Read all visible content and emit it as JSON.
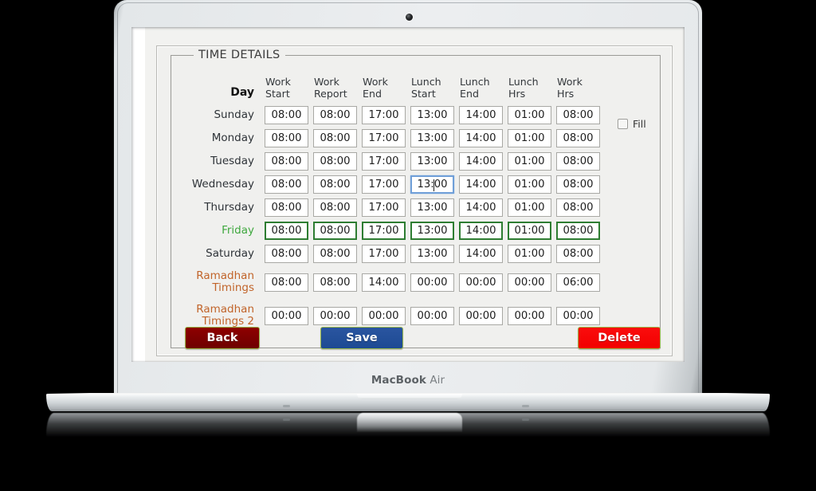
{
  "device": {
    "brand": "MacBook",
    "model": "Air",
    "camera_icon": "camera-dot"
  },
  "window": {
    "fieldset_legend": "TIME DETAILS"
  },
  "table": {
    "day_header": "Day",
    "columns": [
      {
        "line1": "Work",
        "line2": "Start"
      },
      {
        "line1": "Work",
        "line2": "Report"
      },
      {
        "line1": "Work",
        "line2": "End"
      },
      {
        "line1": "Lunch",
        "line2": "Start"
      },
      {
        "line1": "Lunch",
        "line2": "End"
      },
      {
        "line1": "Lunch",
        "line2": "Hrs"
      },
      {
        "line1": "Work",
        "line2": "Hrs"
      }
    ],
    "rows": [
      {
        "day": "Sunday",
        "style": "normal",
        "values": [
          "08:00",
          "08:00",
          "17:00",
          "13:00",
          "14:00",
          "01:00",
          "08:00"
        ]
      },
      {
        "day": "Monday",
        "style": "normal",
        "values": [
          "08:00",
          "08:00",
          "17:00",
          "13:00",
          "14:00",
          "01:00",
          "08:00"
        ]
      },
      {
        "day": "Tuesday",
        "style": "normal",
        "values": [
          "08:00",
          "08:00",
          "17:00",
          "13:00",
          "14:00",
          "01:00",
          "08:00"
        ]
      },
      {
        "day": "Wednesday",
        "style": "normal",
        "values": [
          "08:00",
          "08:00",
          "17:00",
          "13:00",
          "14:00",
          "01:00",
          "08:00"
        ],
        "focused_index": 3
      },
      {
        "day": "Thursday",
        "style": "normal",
        "values": [
          "08:00",
          "08:00",
          "17:00",
          "13:00",
          "14:00",
          "01:00",
          "08:00"
        ]
      },
      {
        "day": "Friday",
        "style": "friday",
        "values": [
          "08:00",
          "08:00",
          "17:00",
          "13:00",
          "14:00",
          "01:00",
          "08:00"
        ]
      },
      {
        "day": "Saturday",
        "style": "normal",
        "values": [
          "08:00",
          "08:00",
          "17:00",
          "13:00",
          "14:00",
          "01:00",
          "08:00"
        ]
      },
      {
        "day": "Ramadhan Timings",
        "day_l1": "Ramadhan",
        "day_l2": "Timings",
        "style": "ramadhan",
        "values": [
          "08:00",
          "08:00",
          "14:00",
          "00:00",
          "00:00",
          "00:00",
          "06:00"
        ]
      },
      {
        "day": "Ramadhan Timings 2",
        "day_l1": "Ramadhan",
        "day_l2": "Timings 2",
        "style": "ramadhan",
        "values": [
          "00:00",
          "00:00",
          "00:00",
          "00:00",
          "00:00",
          "00:00",
          "00:00"
        ]
      }
    ]
  },
  "fill": {
    "label": "Fill",
    "checked": false
  },
  "buttons": {
    "back": "Back",
    "save": "Save",
    "delete": "Delete"
  },
  "colors": {
    "friday_text": "#3fa83f",
    "ramadhan_text": "#c1642a",
    "friday_border": "#2e7d32",
    "focus_border": "#6f9fd8",
    "back_bg": "#6e0000",
    "save_bg": "#1d4a93",
    "delete_bg": "#f20000",
    "button_border": "#9ab84a"
  }
}
